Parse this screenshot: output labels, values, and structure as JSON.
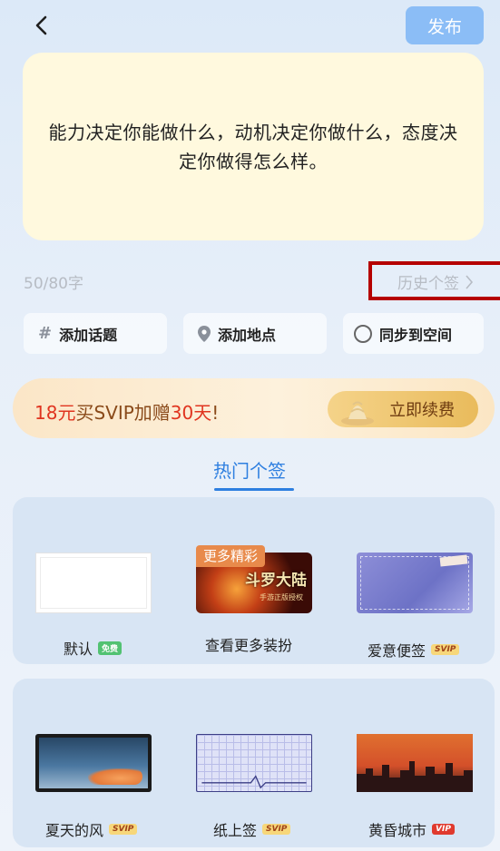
{
  "header": {
    "publish_label": "发布"
  },
  "note": {
    "text": "能力决定你能做什么，动机决定你做什么，态度决定你做得怎么样。"
  },
  "meta": {
    "char_count": "50/80字",
    "history_label": "历史个签"
  },
  "options": {
    "topic_label": "添加话题",
    "location_label": "添加地点",
    "sync_label": "同步到空间"
  },
  "promo": {
    "text_part1": "18元",
    "text_part2": "买SVIP加赠",
    "text_part3": "30天",
    "text_part4": "!",
    "cta_label": "立即续费"
  },
  "section": {
    "tab_label": "热门个签"
  },
  "styles": [
    {
      "name": "默认",
      "badge": "免费"
    },
    {
      "name": "查看更多装扮",
      "badge": "",
      "tag": "更多精彩",
      "thumb_title": "斗罗大陆",
      "thumb_subtitle": "手游正版授权"
    },
    {
      "name": "爱意便签",
      "badge": "SVIP"
    },
    {
      "name": "夏天的风",
      "badge": "SVIP"
    },
    {
      "name": "纸上签",
      "badge": "SVIP"
    },
    {
      "name": "黄昏城市",
      "badge": "VIP"
    }
  ],
  "colors": {
    "accent": "#2e7fe0",
    "publish_bg": "#8bbdf6",
    "note_bg": "#fff9de"
  }
}
